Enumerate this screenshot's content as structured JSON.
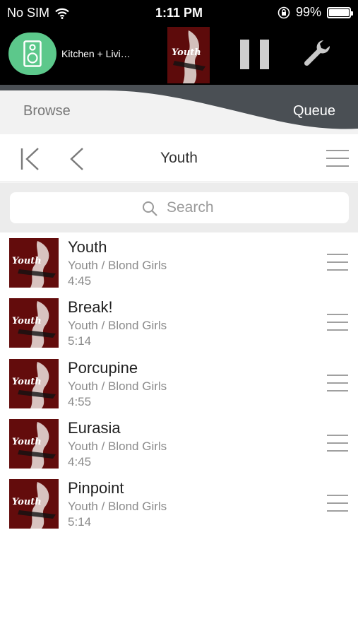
{
  "status": {
    "carrier": "No SIM",
    "time": "1:11 PM",
    "battery": "99%",
    "battery_level": 0.99
  },
  "now_playing": {
    "room": "Kitchen  + Livi…",
    "album_art_text": "Youth"
  },
  "tabs": {
    "browse": "Browse",
    "queue": "Queue"
  },
  "header": {
    "title": "Youth"
  },
  "search": {
    "placeholder": "Search"
  },
  "tracks": [
    {
      "title": "Youth",
      "subtitle": "Youth / Blond Girls",
      "duration": "4:45",
      "art_text": "Youth"
    },
    {
      "title": "Break!",
      "subtitle": "Youth / Blond Girls",
      "duration": "5:14",
      "art_text": "Youth"
    },
    {
      "title": "Porcupine",
      "subtitle": "Youth / Blond Girls",
      "duration": "4:55",
      "art_text": "Youth"
    },
    {
      "title": "Eurasia",
      "subtitle": "Youth / Blond Girls",
      "duration": "4:45",
      "art_text": "Youth"
    },
    {
      "title": "Pinpoint",
      "subtitle": "Youth / Blond Girls",
      "duration": "5:14",
      "art_text": "Youth"
    }
  ],
  "icons": {
    "wifi": "wifi-icon",
    "rotation_lock": "rotation-lock-icon",
    "speaker": "speaker-icon",
    "pause": "pause-icon",
    "settings": "wrench-icon",
    "first": "skip-to-first-icon",
    "back": "chevron-left-icon",
    "menu": "hamburger-menu-icon",
    "search": "search-icon"
  },
  "colors": {
    "room_accent": "#5cc88b",
    "tab_active_bg": "#4a4f54",
    "background": "#ffffff"
  }
}
